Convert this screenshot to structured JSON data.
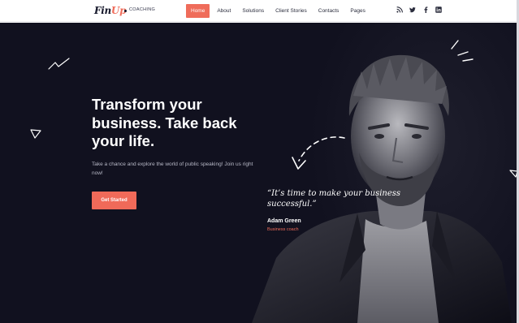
{
  "header": {
    "logo_main": "Fin",
    "logo_accent": "Up",
    "tagline": "COACHING",
    "nav": [
      {
        "label": "Home",
        "active": true
      },
      {
        "label": "About",
        "active": false
      },
      {
        "label": "Solutions",
        "active": false
      },
      {
        "label": "Client Stories",
        "active": false
      },
      {
        "label": "Contacts",
        "active": false
      },
      {
        "label": "Pages",
        "active": false
      }
    ],
    "social_icons": [
      "rss-icon",
      "twitter-icon",
      "facebook-icon",
      "linkedin-icon"
    ]
  },
  "hero": {
    "title": "Transform your business. Take back your life.",
    "subtitle": "Take a chance and explore the world of public speaking! Join us right now!",
    "cta_label": "Get Started",
    "quote": "“It’s time to make your business successful.”",
    "author": "Adam Green",
    "role": "Business coach"
  },
  "colors": {
    "accent": "#ef6c5a",
    "hero_background": "#11111f",
    "header_background": "#ffffff"
  }
}
